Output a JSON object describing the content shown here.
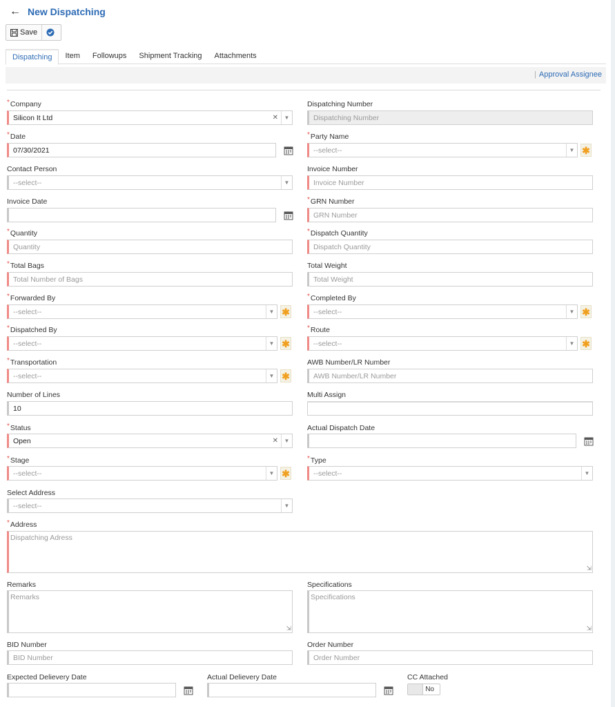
{
  "header": {
    "back_icon": "arrow-left-icon",
    "title": "New Dispatching"
  },
  "toolbar": {
    "save_label": "Save",
    "save_icon": "floppy-disk-icon",
    "submit_icon": "check-circle-icon"
  },
  "tabs": [
    "Dispatching",
    "Item",
    "Followups",
    "Shipment Tracking",
    "Attachments"
  ],
  "subbar": {
    "link": "Approval Assignee"
  },
  "form": {
    "company": {
      "label": "Company",
      "value": "Silicon It Ltd"
    },
    "dispatching_number": {
      "label": "Dispatching Number",
      "placeholder": "Dispatching Number"
    },
    "date": {
      "label": "Date",
      "value": "07/30/2021"
    },
    "party_name": {
      "label": "Party Name",
      "placeholder": "--select--"
    },
    "contact_person": {
      "label": "Contact Person",
      "placeholder": "--select--"
    },
    "invoice_number": {
      "label": "Invoice Number",
      "placeholder": "Invoice Number"
    },
    "invoice_date": {
      "label": "Invoice Date",
      "value": ""
    },
    "grn_number": {
      "label": "GRN Number",
      "placeholder": "GRN Number"
    },
    "quantity": {
      "label": "Quantity",
      "placeholder": "Quantity"
    },
    "dispatch_quantity": {
      "label": "Dispatch Quantity",
      "placeholder": "Dispatch Quantity"
    },
    "total_bags": {
      "label": "Total Bags",
      "placeholder": "Total Number of Bags"
    },
    "total_weight": {
      "label": "Total Weight",
      "placeholder": "Total Weight"
    },
    "forwarded_by": {
      "label": "Forwarded By",
      "placeholder": "--select--"
    },
    "completed_by": {
      "label": "Completed By",
      "placeholder": "--select--"
    },
    "dispatched_by": {
      "label": "Dispatched By",
      "placeholder": "--select--"
    },
    "route": {
      "label": "Route",
      "placeholder": "--select--"
    },
    "transportation": {
      "label": "Transportation",
      "placeholder": "--select--"
    },
    "awb_number": {
      "label": "AWB Number/LR Number",
      "placeholder": "AWB Number/LR Number"
    },
    "number_of_lines": {
      "label": "Number of Lines",
      "value": "10"
    },
    "multi_assign": {
      "label": "Multi Assign",
      "value": ""
    },
    "status": {
      "label": "Status",
      "value": "Open"
    },
    "actual_dispatch_date": {
      "label": "Actual Dispatch Date",
      "value": ""
    },
    "stage": {
      "label": "Stage",
      "placeholder": "--select--"
    },
    "type": {
      "label": "Type",
      "placeholder": "--select--"
    },
    "select_address": {
      "label": "Select Address",
      "placeholder": "--select--"
    },
    "address": {
      "label": "Address",
      "placeholder": "Dispatching Adress"
    },
    "remarks": {
      "label": "Remarks",
      "placeholder": "Remarks"
    },
    "specifications": {
      "label": "Specifications",
      "placeholder": "Specifications"
    },
    "bid_number": {
      "label": "BID Number",
      "placeholder": "BID Number"
    },
    "order_number": {
      "label": "Order Number",
      "placeholder": "Order Number"
    },
    "expected_delivery_date": {
      "label": "Expected Delievery Date",
      "value": ""
    },
    "actual_delivery_date": {
      "label": "Actual Delievery Date",
      "value": ""
    },
    "cc_attached": {
      "label": "CC Attached",
      "value": "No"
    }
  },
  "icons": {
    "calendar": "calendar-icon",
    "star": "asterisk-add-icon",
    "caret": "chevron-down-icon",
    "clear": "clear-x-icon"
  },
  "colors": {
    "accent": "#2d6bb5",
    "required": "#ef8a86",
    "star": "#f0a020"
  }
}
